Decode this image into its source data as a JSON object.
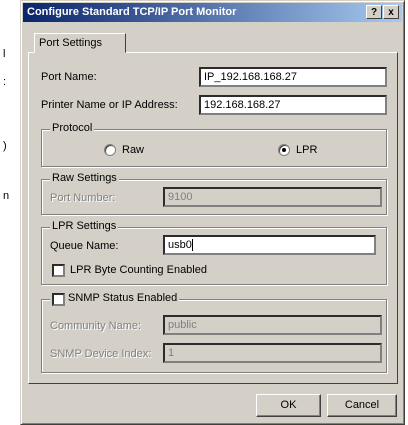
{
  "dialog": {
    "title": "Configure Standard TCP/IP Port Monitor",
    "help_label": "?",
    "close_label": "x"
  },
  "tabs": [
    {
      "label": "Port Settings",
      "selected": true
    }
  ],
  "port_name": {
    "label": "Port Name:",
    "value": "IP_192.168.168.27"
  },
  "printer_address": {
    "label": "Printer Name or IP Address:",
    "value": "192.168.168.27"
  },
  "protocol": {
    "legend": "Protocol",
    "options": [
      {
        "label": "Raw",
        "selected": false
      },
      {
        "label": "LPR",
        "selected": true
      }
    ]
  },
  "raw_settings": {
    "legend": "Raw Settings",
    "port_number_label": "Port Number:",
    "port_number_value": "9100"
  },
  "lpr_settings": {
    "legend": "LPR Settings",
    "queue_name_label": "Queue Name:",
    "queue_name_value": "usb0",
    "byte_counting_label": "LPR Byte Counting Enabled",
    "byte_counting_checked": false
  },
  "snmp": {
    "label": "SNMP Status Enabled",
    "checked": false,
    "community_label": "Community Name:",
    "community_value": "public",
    "device_index_label": "SNMP Device Index:",
    "device_index_value": "1"
  },
  "buttons": {
    "ok": "OK",
    "cancel": "Cancel"
  }
}
